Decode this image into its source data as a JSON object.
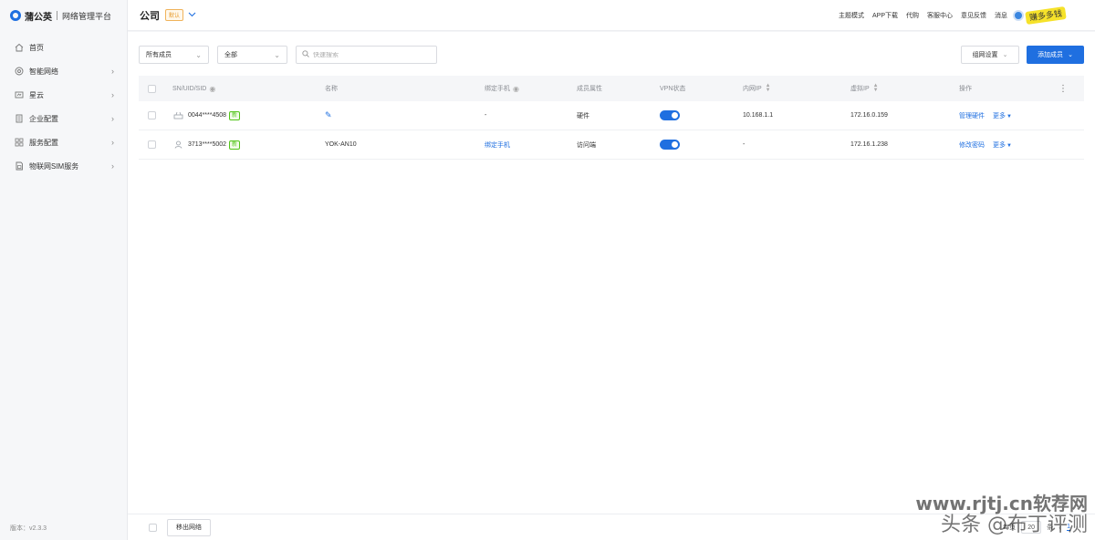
{
  "brand": {
    "name": "蒲公英",
    "subtitle": "网络管理平台"
  },
  "sidebar": {
    "items": [
      {
        "label": "首页",
        "icon": "home-icon",
        "has_children": false
      },
      {
        "label": "智能网络",
        "icon": "network-icon",
        "has_children": true
      },
      {
        "label": "星云",
        "icon": "cloud-icon",
        "has_children": true
      },
      {
        "label": "企业配置",
        "icon": "enterprise-icon",
        "has_children": true
      },
      {
        "label": "服务配置",
        "icon": "service-icon",
        "has_children": true
      },
      {
        "label": "物联网SIM服务",
        "icon": "sim-icon",
        "has_children": true
      }
    ],
    "version": "版本：v2.3.3"
  },
  "header": {
    "company": "公司",
    "badge": "默认",
    "links": [
      "主题模式",
      "APP下载",
      "代购",
      "客服中心",
      "意见反馈",
      "消息"
    ],
    "sticker": "赚多多钱"
  },
  "toolbar": {
    "member_filter": "所有成员",
    "type_filter": "全部",
    "search_placeholder": "快速搜索",
    "settings_label": "组网设置",
    "add_label": "添加成员"
  },
  "table": {
    "columns": {
      "sn": "SN/UID/SID",
      "name": "名称",
      "phone": "绑定手机",
      "attr": "成员属性",
      "vpn": "VPN状态",
      "lan_ip": "内网IP",
      "virtual_ip": "虚拟IP",
      "op": "操作"
    },
    "rows": [
      {
        "sn": "0044****4508",
        "tag": "新",
        "device": "router-icon",
        "name": "",
        "name_editable": true,
        "phone": "-",
        "phone_link": false,
        "attr": "硬件",
        "vpn_on": true,
        "lan_ip": "10.168.1.1",
        "virtual_ip": "172.16.0.159",
        "op": "管理硬件",
        "more": "更多"
      },
      {
        "sn": "3713****5002",
        "tag": "新",
        "device": "user-icon",
        "name": "YOK-AN10",
        "name_editable": false,
        "phone": "绑定手机",
        "phone_link": true,
        "attr": "访问端",
        "vpn_on": true,
        "lan_ip": "-",
        "virtual_ip": "172.16.1.238",
        "op": "修改密码",
        "more": "更多"
      }
    ]
  },
  "footer": {
    "remove_label": "移出网络",
    "per_page_label": "每页",
    "page_size": "20",
    "unit": "条",
    "current_page": "1"
  },
  "watermark": {
    "line1": "www.rjtj.cn软荐网",
    "line2": "头条 @布丁评测"
  },
  "colors": {
    "accent": "#1f6fe0",
    "new_tag": "#52c41a",
    "default_badge": "#e79a2b"
  }
}
